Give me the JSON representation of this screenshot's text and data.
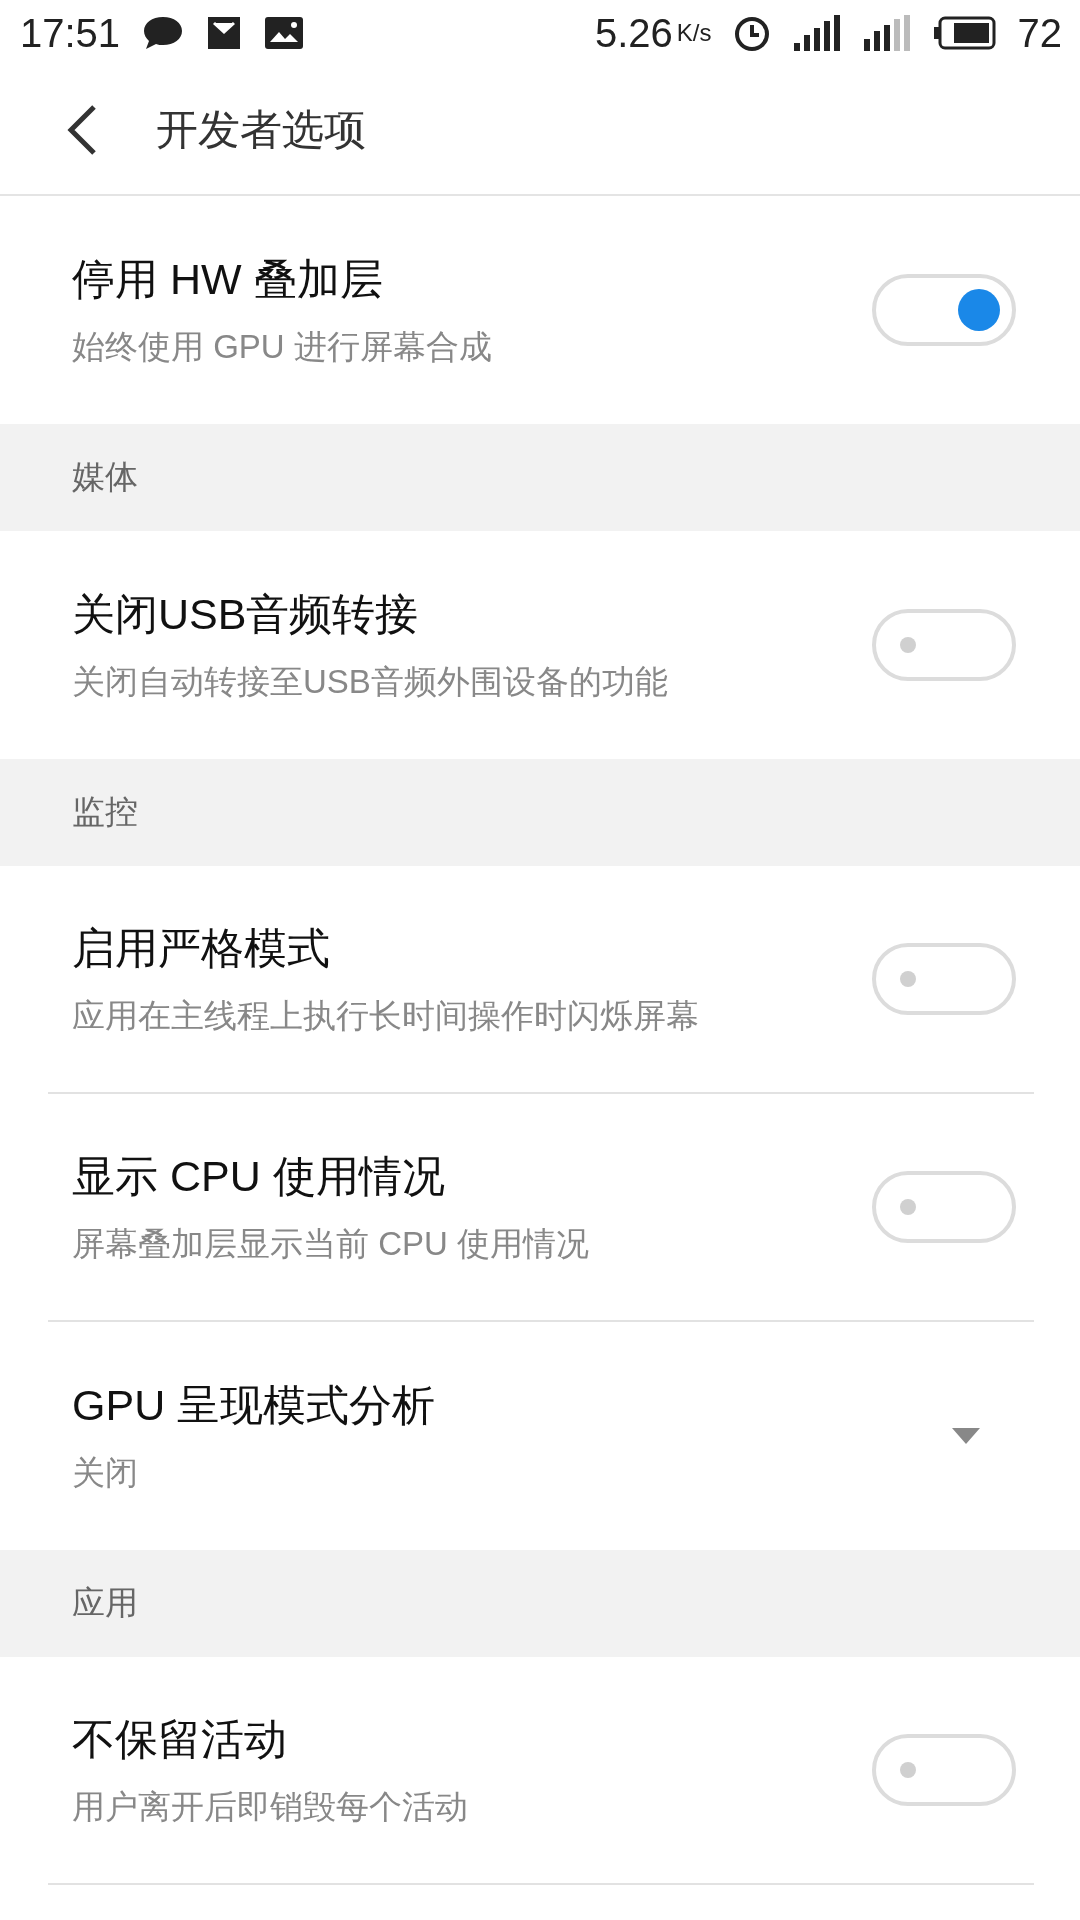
{
  "status_bar": {
    "time": "17:51",
    "speed": "5.26",
    "speed_unit": "K/s",
    "battery": "72"
  },
  "header": {
    "title": "开发者选项"
  },
  "groups": [
    {
      "items": [
        {
          "kind": "toggle",
          "title": "停用 HW 叠加层",
          "subtitle": "始终使用 GPU 进行屏幕合成",
          "on": true
        }
      ]
    },
    {
      "header": "媒体",
      "items": [
        {
          "kind": "toggle",
          "title": "关闭USB音频转接",
          "subtitle": "关闭自动转接至USB音频外围设备的功能",
          "on": false
        }
      ]
    },
    {
      "header": "监控",
      "items": [
        {
          "kind": "toggle",
          "title": "启用严格模式",
          "subtitle": "应用在主线程上执行长时间操作时闪烁屏幕",
          "on": false
        },
        {
          "kind": "toggle",
          "title": "显示 CPU 使用情况",
          "subtitle": "屏幕叠加层显示当前 CPU 使用情况",
          "on": false
        },
        {
          "kind": "dropdown",
          "title": "GPU 呈现模式分析",
          "subtitle": "关闭"
        }
      ]
    },
    {
      "header": "应用",
      "items": [
        {
          "kind": "toggle",
          "title": "不保留活动",
          "subtitle": "用户离开后即销毁每个活动",
          "on": false
        }
      ]
    }
  ]
}
